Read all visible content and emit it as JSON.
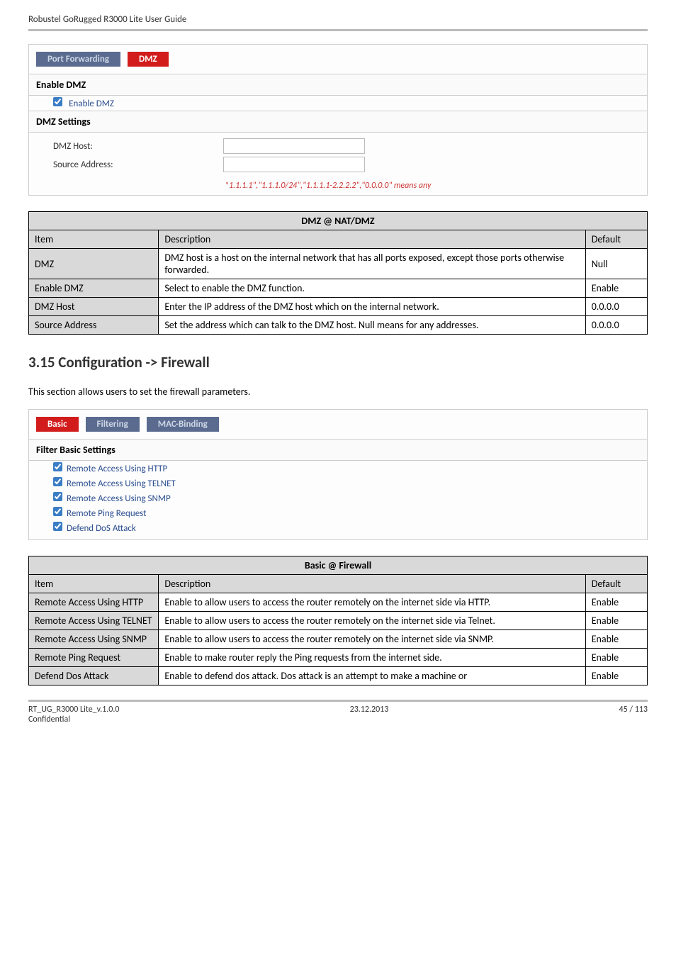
{
  "doc_header": "Robustel GoRugged R3000 Lite User Guide",
  "dmz_panel": {
    "tab_inactive": "Port Forwarding",
    "tab_active": "DMZ",
    "enable_header": "Enable DMZ",
    "enable_checkbox": "Enable DMZ",
    "settings_header": "DMZ Settings",
    "host_label": "DMZ Host:",
    "source_label": "Source Address:",
    "hint": "*1.1.1.1\",\"1.1.1.0/24\",\"1.1.1.1-2.2.2.2\",\"0.0.0.0\" means any"
  },
  "dmz_table": {
    "title": "DMZ @ NAT/DMZ",
    "head_item": "Item",
    "head_desc": "Description",
    "head_def": "Default",
    "rows": [
      {
        "item": "DMZ",
        "desc": "DMZ host is a host on the internal network that has all ports exposed, except those ports otherwise forwarded.",
        "def": "Null"
      },
      {
        "item": "Enable DMZ",
        "desc": "Select to enable the DMZ function.",
        "def": "Enable"
      },
      {
        "item": "DMZ Host",
        "desc": "Enter the IP address of the DMZ host which on the internal network.",
        "def": "0.0.0.0"
      },
      {
        "item": "Source Address",
        "desc": "Set the address which can talk to the DMZ host. Null means for any addresses.",
        "def": "0.0.0.0"
      }
    ]
  },
  "section_title": "3.15  Configuration -> Firewall",
  "intro": "This section allows users to set the firewall parameters.",
  "fw_panel": {
    "tab_active": "Basic",
    "tab_inactive1": "Filtering",
    "tab_inactive2": "MAC-Binding",
    "header": "Filter Basic Settings",
    "cb1": "Remote Access Using HTTP",
    "cb2": "Remote Access Using TELNET",
    "cb3": "Remote Access Using SNMP",
    "cb4": "Remote Ping Request",
    "cb5": "Defend DoS Attack"
  },
  "fw_table": {
    "title": "Basic @ Firewall",
    "head_item": "Item",
    "head_desc": "Description",
    "head_def": "Default",
    "rows": [
      {
        "item": "Remote Access Using HTTP",
        "desc": "Enable to allow users to access the router remotely on the internet side via HTTP.",
        "def": "Enable"
      },
      {
        "item": "Remote Access Using TELNET",
        "desc": "Enable to allow users to access the router remotely on the internet side via Telnet.",
        "def": "Enable"
      },
      {
        "item": "Remote Access Using SNMP",
        "desc": "Enable to allow users to access the router remotely on the internet side via SNMP.",
        "def": "Enable"
      },
      {
        "item": "Remote Ping Request",
        "desc": "Enable to make router reply the Ping requests from the internet side.",
        "def": "Enable"
      },
      {
        "item": "Defend Dos Attack",
        "desc": "Enable to defend dos attack. Dos attack is an attempt to make a machine or",
        "def": "Enable"
      }
    ]
  },
  "footer": {
    "left1": "RT_UG_R3000 Lite_v.1.0.0",
    "left2": "Confidential",
    "center": "23.12.2013",
    "right": "45 / 113"
  },
  "chart_data": {
    "type": "table",
    "tables": [
      {
        "title": "DMZ @ NAT/DMZ",
        "columns": [
          "Item",
          "Description",
          "Default"
        ],
        "rows": [
          [
            "DMZ",
            "DMZ host is a host on the internal network that has all ports exposed, except those ports otherwise forwarded.",
            "Null"
          ],
          [
            "Enable DMZ",
            "Select to enable the DMZ function.",
            "Enable"
          ],
          [
            "DMZ Host",
            "Enter the IP address of the DMZ host which on the internal network.",
            "0.0.0.0"
          ],
          [
            "Source Address",
            "Set the address which can talk to the DMZ host. Null means for any addresses.",
            "0.0.0.0"
          ]
        ]
      },
      {
        "title": "Basic @ Firewall",
        "columns": [
          "Item",
          "Description",
          "Default"
        ],
        "rows": [
          [
            "Remote Access Using HTTP",
            "Enable to allow users to access the router remotely on the internet side via HTTP.",
            "Enable"
          ],
          [
            "Remote Access Using TELNET",
            "Enable to allow users to access the router remotely on the internet side via Telnet.",
            "Enable"
          ],
          [
            "Remote Access Using SNMP",
            "Enable to allow users to access the router remotely on the internet side via SNMP.",
            "Enable"
          ],
          [
            "Remote Ping Request",
            "Enable to make router reply the Ping requests from the internet side.",
            "Enable"
          ],
          [
            "Defend Dos Attack",
            "Enable to defend dos attack. Dos attack is an attempt to make a machine or",
            "Enable"
          ]
        ]
      }
    ]
  }
}
